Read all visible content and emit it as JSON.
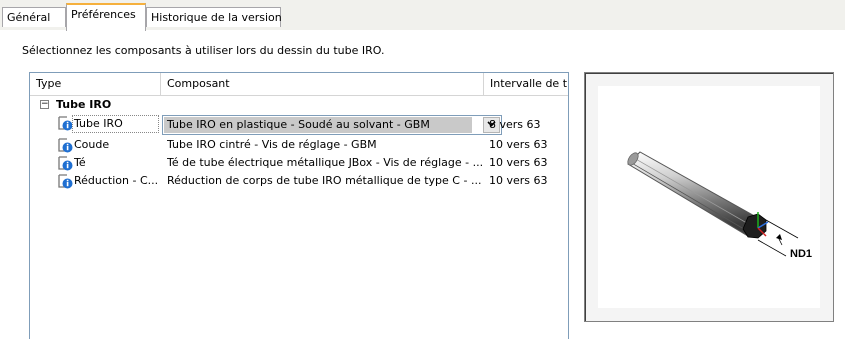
{
  "tabs": [
    {
      "label": "Général",
      "active": false
    },
    {
      "label": "Préférences",
      "active": true
    },
    {
      "label": "Historique de la version",
      "active": false
    }
  ],
  "instruction": "Sélectionnez les composants à utiliser lors du dessin du tube IRO.",
  "columns": [
    "Type",
    "Composant",
    "Intervalle de t"
  ],
  "group": {
    "expander": "⊟",
    "name": "Tube IRO"
  },
  "rows": [
    {
      "type": "Tube IRO",
      "component": "Tube IRO en plastique - Soudé au solvant - GBM",
      "range": "8 vers 63",
      "selected": true
    },
    {
      "type": "Coude",
      "component": "Tube IRO cintré - Vis de réglage - GBM",
      "range": "10 vers 63"
    },
    {
      "type": "Té",
      "component": "Té de tube électrique métallique JBox - Vis de réglage - ...",
      "range": "10 vers 63"
    },
    {
      "type": "Réduction - C...",
      "component": "Réduction de corps de tube IRO métallique de type C - ...",
      "range": "10 vers 63"
    }
  ],
  "combo_arrow_icon": "chevron-down-icon",
  "preview": {
    "label": "ND1"
  },
  "colors": {
    "active_tab_accent": "#f5b03d",
    "selection": "#c9c9c9",
    "list_border": "#7f9db9",
    "info_icon": "#1f6fd1"
  }
}
